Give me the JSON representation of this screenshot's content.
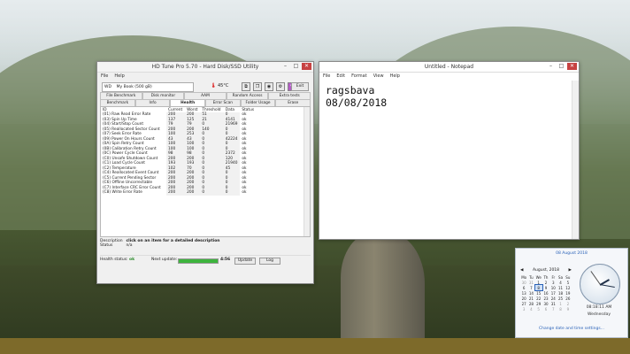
{
  "hdtune": {
    "title": "HD Tune Pro 5.70 - Hard Disk/SSD Utility",
    "menu": [
      "File",
      "Help"
    ],
    "drive_prefix": "WD",
    "drive_name": "My Book (500 gB)",
    "temperature": "45°C",
    "exit_label": "Exit",
    "tabs_top": [
      "File Benchmark",
      "Disk monitor",
      "AAM",
      "Random Access",
      "Extra tests"
    ],
    "tabs_bottom": [
      "Benchmark",
      "Info",
      "Health",
      "Error Scan",
      "Folder Usage",
      "Erase"
    ],
    "columns": [
      "ID",
      "Current",
      "Worst",
      "Threshold",
      "Data",
      "Status"
    ],
    "rows": [
      [
        "(01) Raw Read Error Rate",
        "200",
        "200",
        "51",
        "0",
        "ok"
      ],
      [
        "(03) Spin Up Time",
        "137",
        "125",
        "21",
        "4141",
        "ok"
      ],
      [
        "(04) Start/Stop Count",
        "79",
        "79",
        "0",
        "21969",
        "ok"
      ],
      [
        "(05) Reallocated Sector Count",
        "200",
        "200",
        "140",
        "0",
        "ok"
      ],
      [
        "(07) Seek Error Rate",
        "100",
        "253",
        "0",
        "0",
        "ok"
      ],
      [
        "(09) Power On Hours Count",
        "43",
        "43",
        "0",
        "42224",
        "ok"
      ],
      [
        "(0A) Spin Retry Count",
        "100",
        "100",
        "0",
        "0",
        "ok"
      ],
      [
        "(0B) Calibration Retry Count",
        "100",
        "100",
        "0",
        "0",
        "ok"
      ],
      [
        "(0C) Power Cycle Count",
        "98",
        "98",
        "0",
        "2372",
        "ok"
      ],
      [
        "(C0) Unsafe Shutdown Count",
        "200",
        "200",
        "0",
        "120",
        "ok"
      ],
      [
        "(C1) Load Cycle Count",
        "193",
        "193",
        "0",
        "21940",
        "ok"
      ],
      [
        "(C2) Temperature",
        "102",
        "70",
        "0",
        "45",
        "ok"
      ],
      [
        "(C4) Reallocated Event Count",
        "200",
        "200",
        "0",
        "0",
        "ok"
      ],
      [
        "(C5) Current Pending Sector",
        "200",
        "200",
        "0",
        "0",
        "ok"
      ],
      [
        "(C6) Offline Uncorrectable",
        "200",
        "200",
        "0",
        "0",
        "ok"
      ],
      [
        "(C7) Interface CRC Error Count",
        "200",
        "200",
        "0",
        "0",
        "ok"
      ],
      [
        "(C8) Write Error Rate",
        "200",
        "200",
        "0",
        "0",
        "ok"
      ]
    ],
    "description_label": "Description",
    "description_value": "click on an item for a detailed description",
    "status_label": "Status",
    "status_value": "n/a",
    "health_label": "Health status:",
    "health_value": "ok",
    "next_update_label": "Next update:",
    "next_update_progress": 1.0,
    "next_update_time": "4:56",
    "update_label": "Update",
    "log_label": "Log"
  },
  "notepad": {
    "title": "Untitled - Notepad",
    "menu": [
      "File",
      "Edit",
      "Format",
      "View",
      "Help"
    ],
    "content": "ragsbava\n08/08/2018"
  },
  "clock": {
    "date_header": "08 August 2018",
    "month_label": "August, 2018",
    "weekdays": [
      "Mo",
      "Tu",
      "We",
      "Th",
      "Fr",
      "Sa",
      "Su"
    ],
    "weeks": [
      [
        "30",
        "31",
        "1",
        "2",
        "3",
        "4",
        "5"
      ],
      [
        "6",
        "7",
        "8",
        "9",
        "10",
        "11",
        "12"
      ],
      [
        "13",
        "14",
        "15",
        "16",
        "17",
        "18",
        "19"
      ],
      [
        "20",
        "21",
        "22",
        "23",
        "24",
        "25",
        "26"
      ],
      [
        "27",
        "28",
        "29",
        "30",
        "31",
        "1",
        "2"
      ],
      [
        "3",
        "4",
        "5",
        "6",
        "7",
        "8",
        "9"
      ]
    ],
    "today": "8",
    "time": "08:18:11 AM",
    "weekday": "Wednesday",
    "link": "Change date and time settings..."
  },
  "window_controls": {
    "minimize": "–",
    "maximize": "□",
    "close": "✕"
  }
}
